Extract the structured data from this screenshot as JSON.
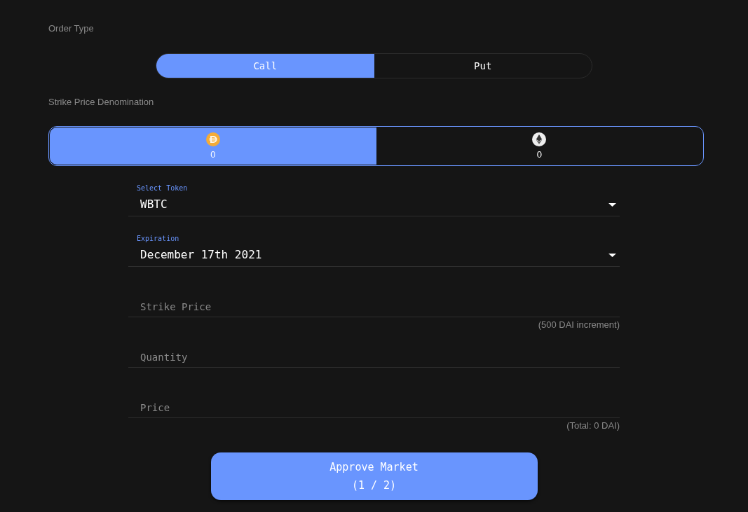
{
  "order_type": {
    "label": "Order Type",
    "options": [
      {
        "label": "Call",
        "selected": true
      },
      {
        "label": "Put",
        "selected": false
      }
    ]
  },
  "strike_price_denomination": {
    "label": "Strike Price Denomination",
    "options": [
      {
        "kind": "dai",
        "value": "0",
        "selected": true
      },
      {
        "kind": "eth",
        "value": "0",
        "selected": false
      }
    ]
  },
  "fields": [
    {
      "kind": "select",
      "label": "Select Token",
      "value": "WBTC"
    },
    {
      "kind": "select",
      "label": "Expiration",
      "value": "December 17th 2021"
    },
    {
      "kind": "input",
      "placeholder": "Strike Price",
      "helper": "(500 DAI increment)"
    },
    {
      "kind": "input",
      "placeholder": "Quantity"
    },
    {
      "kind": "input",
      "placeholder": "Price",
      "helper": "(Total: 0 DAI)"
    }
  ],
  "submit_button": {
    "lines": [
      "Approve Market",
      "(1 / 2)"
    ]
  }
}
